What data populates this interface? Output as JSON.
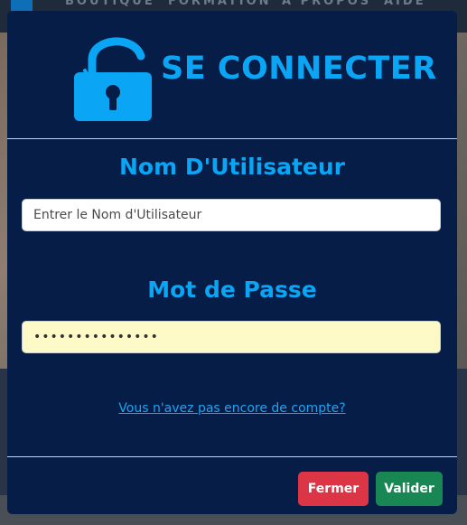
{
  "background": {
    "nav_links": [
      "BOUTIQUE",
      "FORMATION",
      "À PROPOS",
      "AIDE"
    ]
  },
  "modal": {
    "title": "SE CONNECTER",
    "username_label": "Nom D'Utilisateur",
    "username_placeholder": "Entrer le Nom d'Utilisateur",
    "username_value": "",
    "password_label": "Mot de Passe",
    "password_value": "•••••••••••••••",
    "signup_link": "Vous n'avez pas encore de compte?",
    "close_label": "Fermer",
    "submit_label": "Valider"
  },
  "colors": {
    "modal_bg": "#051d47",
    "accent": "#0aa6f5",
    "close_button": "#dc3545",
    "submit_button": "#198754",
    "autofill_bg": "#fefac8"
  },
  "icons": {
    "header": "unlocked-padlock-icon",
    "nav": "home-icon"
  }
}
